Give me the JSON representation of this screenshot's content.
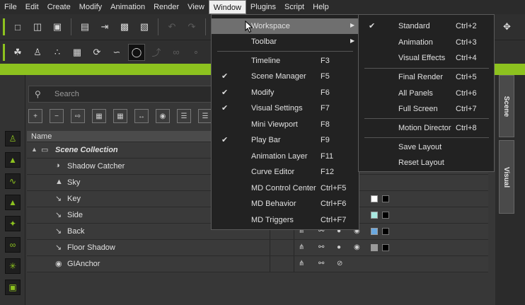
{
  "menubar": {
    "items": [
      "File",
      "Edit",
      "Create",
      "Modify",
      "Animation",
      "Render",
      "View",
      "Window",
      "Plugins",
      "Script",
      "Help"
    ],
    "active": "Window"
  },
  "search": {
    "placeholder": "Search"
  },
  "table": {
    "header": "Name",
    "rows": [
      {
        "label": "Scene Collection",
        "icon": "folder-icon"
      },
      {
        "label": "Shadow Catcher",
        "icon": "shadow-catcher-icon"
      },
      {
        "label": "Sky",
        "icon": "sky-icon"
      },
      {
        "label": "Key",
        "icon": "light-icon",
        "swatch": "#ffffff"
      },
      {
        "label": "Side",
        "icon": "light-icon",
        "swatch": "#a8e8e0"
      },
      {
        "label": "Back",
        "icon": "light-icon",
        "swatch": "#6aa8e0"
      },
      {
        "label": "Floor Shadow",
        "icon": "light-icon",
        "swatch": "#9a9a9a"
      },
      {
        "label": "GIAnchor",
        "icon": "anchor-icon"
      }
    ]
  },
  "window_menu": {
    "items": [
      {
        "label": "Workspace",
        "shortcut": "",
        "checked": false,
        "submenu": true
      },
      {
        "label": "Toolbar",
        "shortcut": "",
        "checked": false,
        "submenu": true
      },
      {
        "label": "Timeline",
        "shortcut": "F3",
        "checked": false
      },
      {
        "label": "Scene Manager",
        "shortcut": "F5",
        "checked": true
      },
      {
        "label": "Modify",
        "shortcut": "F6",
        "checked": true
      },
      {
        "label": "Visual Settings",
        "shortcut": "F7",
        "checked": true
      },
      {
        "label": "Mini Viewport",
        "shortcut": "F8",
        "checked": false
      },
      {
        "label": "Play Bar",
        "shortcut": "F9",
        "checked": true
      },
      {
        "label": "Animation Layer",
        "shortcut": "F11",
        "checked": false
      },
      {
        "label": "Curve Editor",
        "shortcut": "F12",
        "checked": false
      },
      {
        "label": "MD Control Center",
        "shortcut": "Ctrl+F5",
        "checked": false
      },
      {
        "label": "MD Behavior",
        "shortcut": "Ctrl+F6",
        "checked": false
      },
      {
        "label": "MD Triggers",
        "shortcut": "Ctrl+F7",
        "checked": false
      }
    ]
  },
  "workspace_submenu": {
    "items": [
      {
        "label": "Standard",
        "shortcut": "Ctrl+2",
        "checked": true
      },
      {
        "label": "Animation",
        "shortcut": "Ctrl+3",
        "checked": false
      },
      {
        "label": "Visual Effects",
        "shortcut": "Ctrl+4",
        "checked": false
      },
      {
        "label": "Final Render",
        "shortcut": "Ctrl+5",
        "checked": false
      },
      {
        "label": "All Panels",
        "shortcut": "Ctrl+6",
        "checked": false
      },
      {
        "label": "Full Screen",
        "shortcut": "Ctrl+7",
        "checked": false
      },
      {
        "label": "Motion Director",
        "shortcut": "Ctrl+8",
        "checked": false
      },
      {
        "label": "Save Layout",
        "shortcut": "",
        "checked": false
      },
      {
        "label": "Reset Layout",
        "shortcut": "",
        "checked": false
      }
    ]
  },
  "dock_tabs": [
    "Scene",
    "Visual"
  ],
  "colors": {
    "accent": "#8dc21f",
    "menu_bg": "#222222",
    "highlight": "#6f6f6f"
  }
}
